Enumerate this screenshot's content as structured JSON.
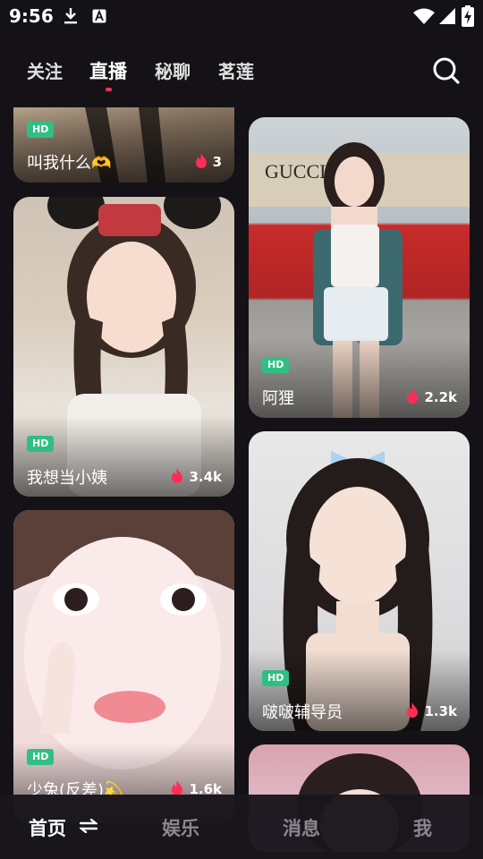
{
  "status_bar": {
    "time": "9:56",
    "icons": [
      "download-icon",
      "a-letter-icon",
      "wifi-icon",
      "signal-icon",
      "battery-charging-icon"
    ]
  },
  "top_tabs": {
    "items": [
      {
        "label": "关注",
        "active": false
      },
      {
        "label": "直播",
        "active": true
      },
      {
        "label": "秘聊",
        "active": false
      },
      {
        "label": "茗莲",
        "active": false
      }
    ],
    "search_icon": "search-icon",
    "indicator_color": "#ff2d55"
  },
  "cards": [
    {
      "badge": "HD",
      "title": "叫我什么🫶",
      "viewers": "3"
    },
    {
      "badge": "HD",
      "title": "阿狸",
      "viewers": "2.2k"
    },
    {
      "badge": "HD",
      "title": "我想当小姨",
      "viewers": "3.4k"
    },
    {
      "badge": "HD",
      "title": "啵啵辅导员",
      "viewers": "1.3k"
    },
    {
      "badge": "HD",
      "title": "少兔(反差)💫",
      "viewers": "1.6k"
    },
    {
      "badge": "",
      "title": "",
      "viewers": ""
    }
  ],
  "bottom_nav": {
    "items": [
      {
        "label": "首页",
        "active": true,
        "icon": "swap-arrows-icon"
      },
      {
        "label": "娱乐",
        "active": false
      },
      {
        "label": "消息",
        "active": false
      },
      {
        "label": "我",
        "active": false
      }
    ]
  },
  "colors": {
    "background": "#141217",
    "hd_badge": "#2fbf82",
    "flame": "#ff2d55"
  }
}
